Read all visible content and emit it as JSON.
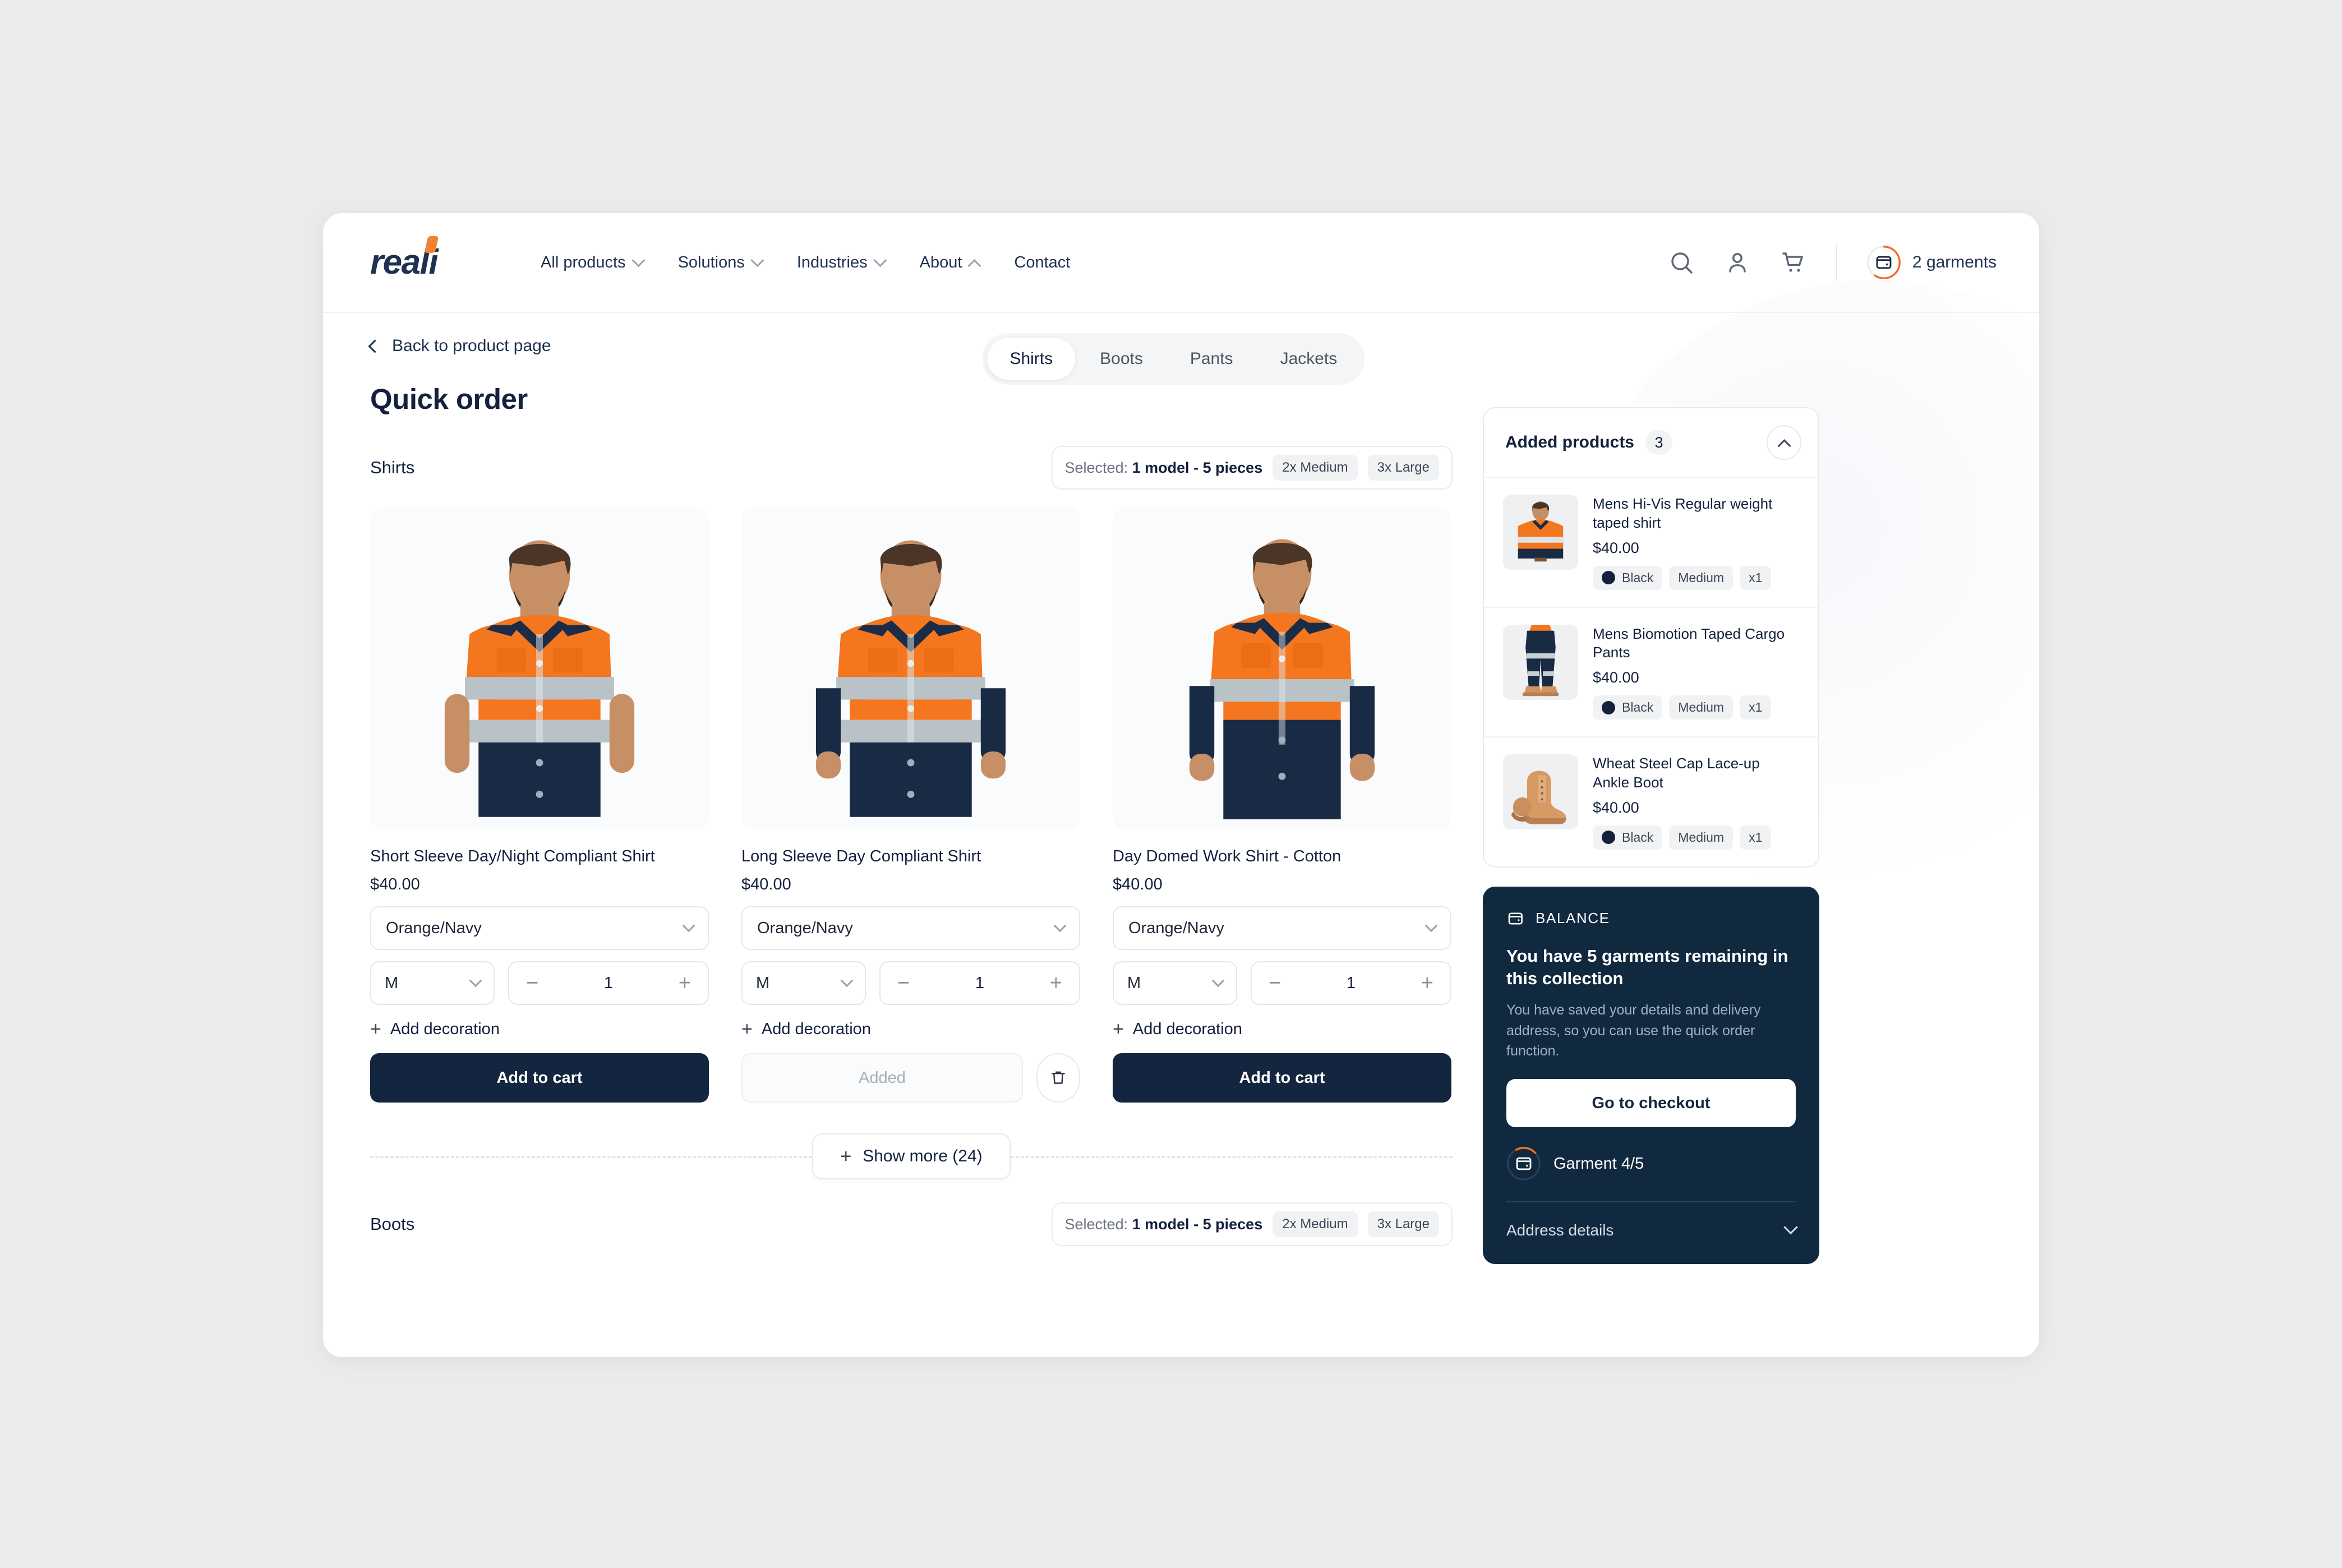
{
  "brand": {
    "name": "reali"
  },
  "header": {
    "nav": [
      {
        "label": "All products",
        "caret": "chevron-down"
      },
      {
        "label": "Solutions",
        "caret": "chevron-down"
      },
      {
        "label": "Industries",
        "caret": "chevron-down"
      },
      {
        "label": "About",
        "caret": "chevron-up"
      },
      {
        "label": "Contact",
        "caret": "none"
      }
    ],
    "icons": [
      "search-icon",
      "user-icon",
      "cart-icon"
    ],
    "garments_badge": {
      "label": "2 garments",
      "icon": "wallet-icon",
      "ring_percent": 60
    }
  },
  "subbar": {
    "back_label": "Back to product page",
    "tabs": [
      {
        "label": "Shirts",
        "active": true
      },
      {
        "label": "Boots",
        "active": false
      },
      {
        "label": "Pants",
        "active": false
      },
      {
        "label": "Jackets",
        "active": false
      }
    ]
  },
  "page": {
    "title": "Quick order"
  },
  "shirts_section": {
    "label": "Shirts",
    "selected": {
      "prefix": "Selected:",
      "summary": "1 model - 5 pieces",
      "badges": [
        "2x Medium",
        "3x Large"
      ]
    },
    "show_more": "Show more (24)"
  },
  "boots_section": {
    "label": "Boots",
    "selected": {
      "prefix": "Selected:",
      "summary": "1 model - 5 pieces",
      "badges": [
        "2x Medium",
        "3x Large"
      ]
    }
  },
  "products": [
    {
      "name": "Short Sleeve Day/Night Compliant Shirt",
      "price": "$40.00",
      "color": "Orange/Navy",
      "size": "M",
      "qty": "1",
      "decoration_label": "Add decoration",
      "cta": "Add to cart",
      "state": "add"
    },
    {
      "name": "Long Sleeve Day Compliant Shirt",
      "price": "$40.00",
      "color": "Orange/Navy",
      "size": "M",
      "qty": "1",
      "decoration_label": "Add decoration",
      "cta": "Added",
      "state": "added",
      "remove_icon": "trash-icon"
    },
    {
      "name": "Day Domed Work Shirt - Cotton",
      "price": "$40.00",
      "color": "Orange/Navy",
      "size": "M",
      "qty": "1",
      "decoration_label": "Add decoration",
      "cta": "Add to cart",
      "state": "add"
    }
  ],
  "added_products": {
    "title": "Added products",
    "count": "3",
    "collapse_icon": "chevron-up-icon",
    "items": [
      {
        "name": "Mens Hi-Vis Regular weight taped shirt",
        "price": "$40.00",
        "color": "Black",
        "size": "Medium",
        "qty": "x1",
        "swatch_hex": "#14213d",
        "thumb": "hivis-shirt"
      },
      {
        "name": "Mens Biomotion Taped Cargo Pants",
        "price": "$40.00",
        "color": "Black",
        "size": "Medium",
        "qty": "x1",
        "swatch_hex": "#14213d",
        "thumb": "cargo-pants"
      },
      {
        "name": "Wheat Steel Cap Lace-up Ankle Boot",
        "price": "$40.00",
        "color": "Black",
        "size": "Medium",
        "qty": "x1",
        "swatch_hex": "#14213d",
        "thumb": "work-boot"
      }
    ]
  },
  "balance": {
    "label": "BALANCE",
    "icon": "wallet-icon",
    "headline": "You have 5 garments remaining in this collection",
    "subtext": "You have saved your details and delivery address, so you can use the quick order function.",
    "checkout_label": "Go to checkout",
    "garment_progress": "Garment 4/5",
    "garment_ring_percent": 20,
    "address_label": "Address details",
    "address_caret": "chevron-down"
  },
  "colors": {
    "brand_navy": "#14213d",
    "brand_orange": "#f58233",
    "panel_navy": "#11293f",
    "page_bg": "#ebebeb",
    "chip_bg": "#f1f2f4"
  }
}
